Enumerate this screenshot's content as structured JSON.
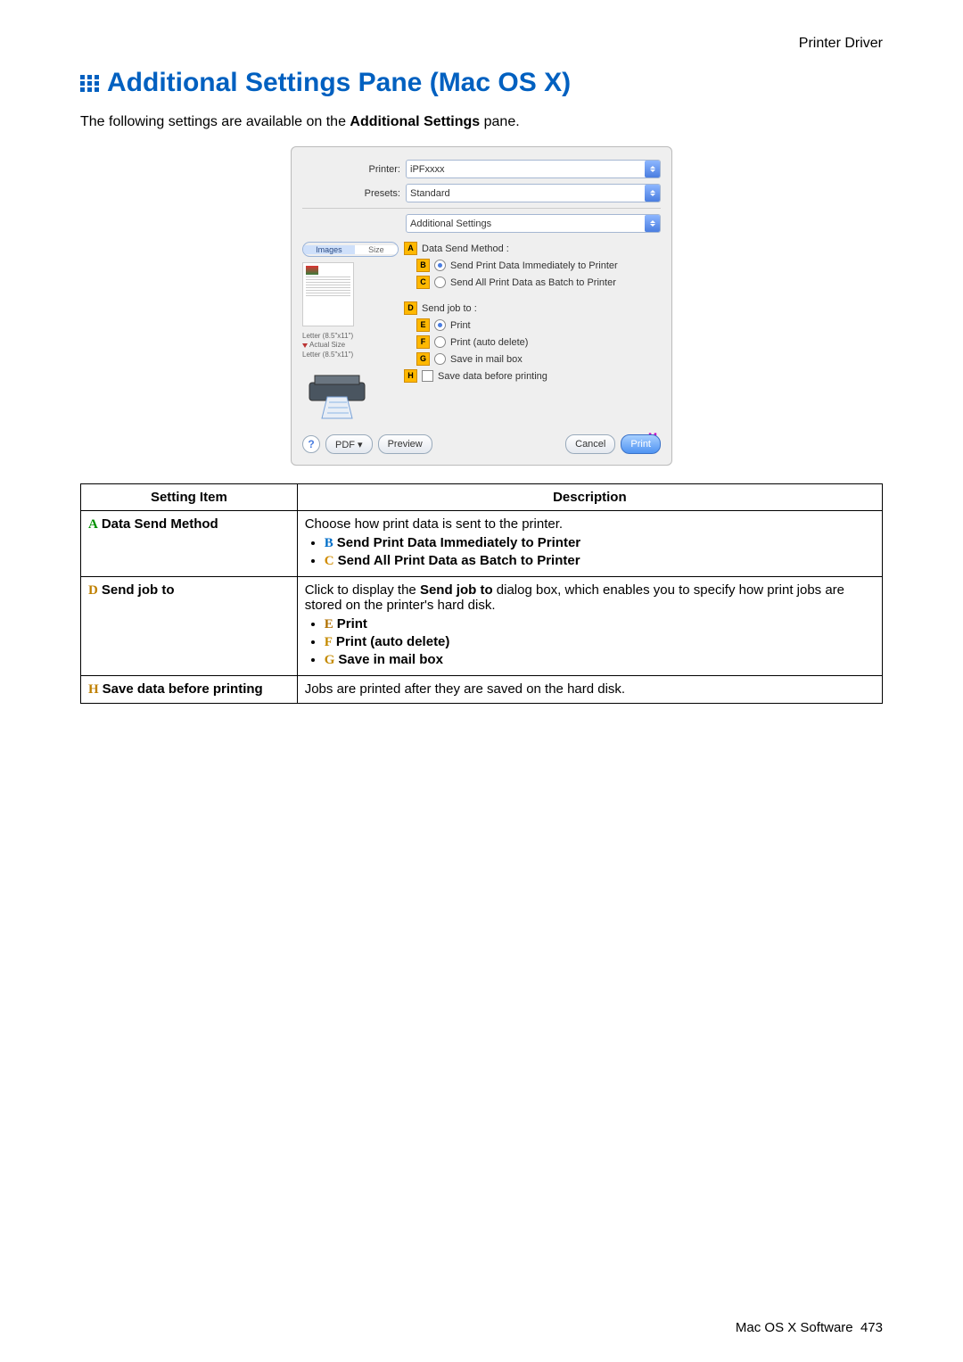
{
  "header": {
    "section": "Printer Driver"
  },
  "title": "Additional Settings Pane (Mac OS X)",
  "intro_pre": "The following settings are available on the ",
  "intro_bold": "Additional Settings",
  "intro_post": " pane.",
  "dialog": {
    "printer_label": "Printer:",
    "printer_value": "iPFxxxx",
    "presets_label": "Presets:",
    "presets_value": "Standard",
    "pane_value": "Additional Settings",
    "tabs": {
      "images": "Images",
      "size": "Size"
    },
    "media_line1": "Letter (8.5\"x11\")",
    "media_actual": "Actual Size",
    "media_line3": "Letter (8.5\"x11\")",
    "A_text": "Data Send Method :",
    "B_text": "Send Print Data Immediately to Printer",
    "C_text": "Send All Print Data as Batch to Printer",
    "D_text": "Send job to :",
    "E_text": "Print",
    "F_text": "Print (auto delete)",
    "G_text": "Save in mail box",
    "H_text": "Save data before printing",
    "M_letter": "M",
    "help": "?",
    "pdf_btn": "PDF ▾",
    "preview_btn": "Preview",
    "cancel_btn": "Cancel",
    "print_btn": "Print"
  },
  "table": {
    "head_setting": "Setting Item",
    "head_desc": "Description",
    "rows": {
      "A": {
        "letter": "A",
        "name": "Data Send Method",
        "desc": "Choose how print data is sent to the printer.",
        "b1_letter": "B",
        "b1_text": "Send Print Data Immediately to Printer",
        "b2_letter": "C",
        "b2_text": "Send All Print Data as Batch to Printer"
      },
      "D": {
        "letter": "D",
        "name": "Send job to",
        "desc_pre": "Click to display the ",
        "desc_bold": "Send job to",
        "desc_post": " dialog box, which enables you to specify how print jobs are stored on the printer's hard disk.",
        "b1_letter": "E",
        "b1_text": "Print",
        "b2_letter": "F",
        "b2_text": "Print (auto delete)",
        "b3_letter": "G",
        "b3_text": "Save in mail box"
      },
      "H": {
        "letter": "H",
        "name": "Save data before printing",
        "desc": "Jobs are printed after they are saved on the hard disk."
      }
    }
  },
  "footer": {
    "text": "Mac OS X Software",
    "page": "473"
  }
}
